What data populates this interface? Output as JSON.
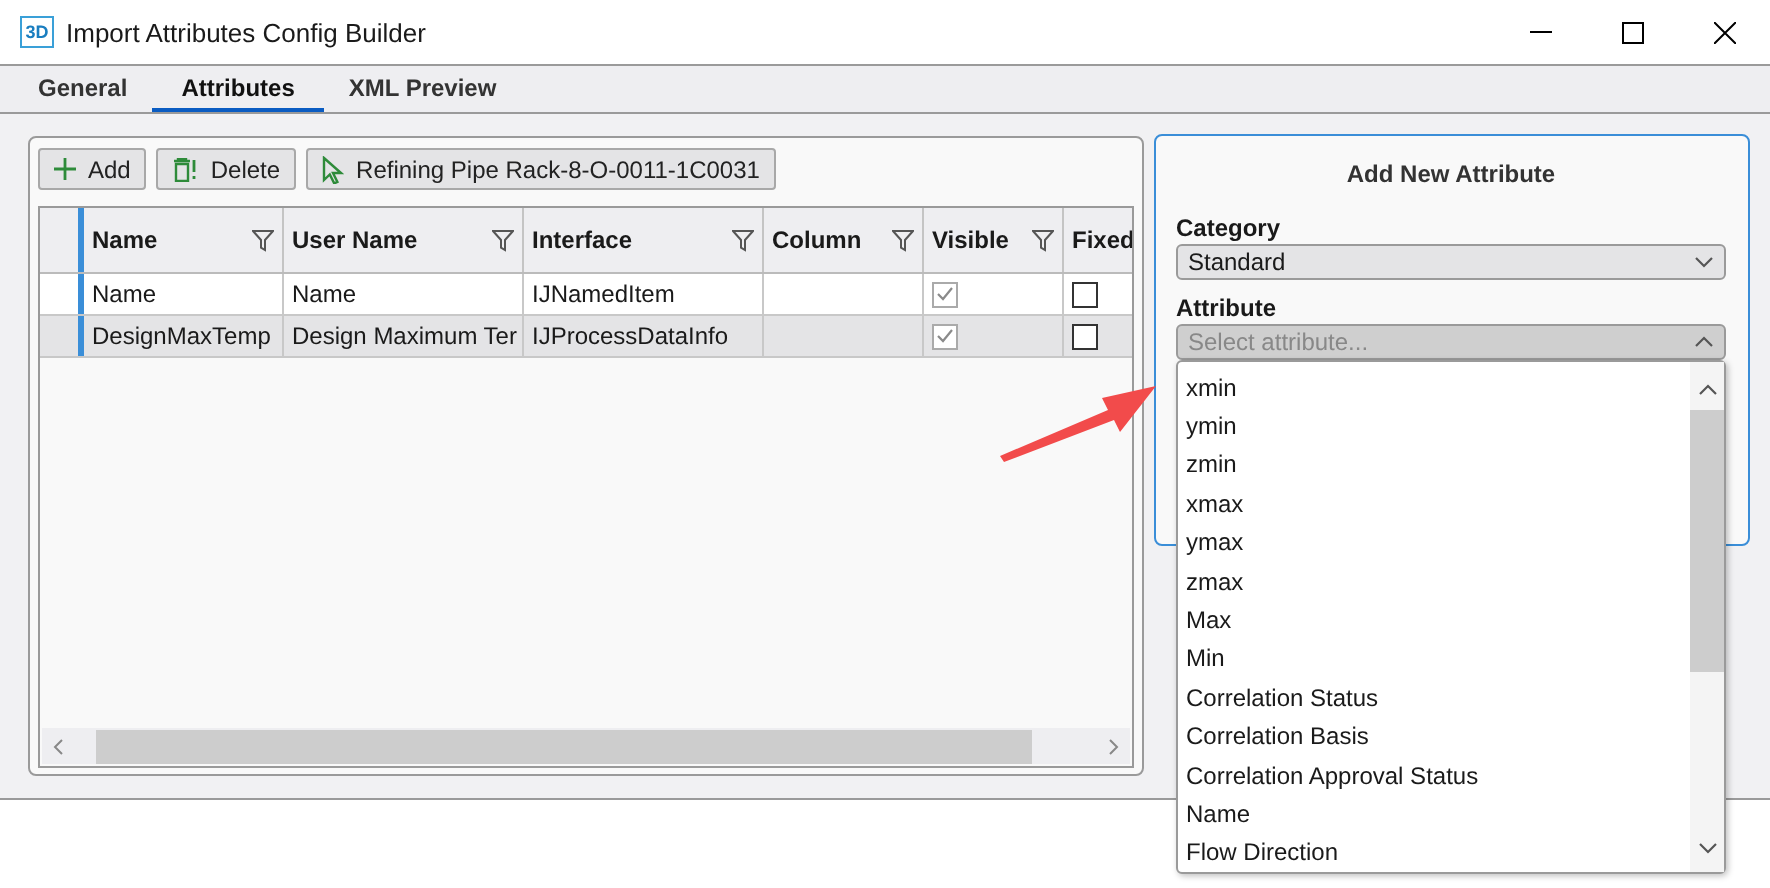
{
  "window": {
    "icon_text": "3D",
    "title": "Import Attributes Config Builder"
  },
  "tabs": [
    {
      "label": "General",
      "selected": false
    },
    {
      "label": "Attributes",
      "selected": true
    },
    {
      "label": "XML Preview",
      "selected": false
    }
  ],
  "toolbar": [
    "Add",
    "Delete",
    "Refining Pipe Rack-8-O-0011-1C0031"
  ],
  "table": {
    "columns": [
      {
        "label": "Name",
        "filter": true
      },
      {
        "label": "User Name",
        "filter": true
      },
      {
        "label": "Interface",
        "filter": true
      },
      {
        "label": "Column",
        "filter": true
      },
      {
        "label": "Visible",
        "filter": true
      },
      {
        "label": "Fixed"
      }
    ],
    "rows": [
      {
        "name": "Name",
        "user_name": "Name",
        "interface": "IJNamedItem",
        "visible": true,
        "fixed": false,
        "selected": false
      },
      {
        "name": "DesignMaxTemp",
        "user_name": "Design Maximum Ter",
        "interface": "IJProcessDataInfo",
        "visible": true,
        "fixed": false,
        "selected": true
      }
    ]
  },
  "panel": {
    "title": "Add New Attribute",
    "category": {
      "label": "Category",
      "value": "Standard"
    },
    "attribute": {
      "label": "Attribute",
      "placeholder": "Select attribute...",
      "expanded": true
    }
  },
  "dropdown_items": [
    "xmin",
    "ymin",
    "zmin",
    "xmax",
    "ymax",
    "zmax",
    "Max",
    "Min",
    "Correlation Status",
    "Correlation Basis",
    "Correlation Approval Status",
    "Name",
    "Flow Direction"
  ]
}
